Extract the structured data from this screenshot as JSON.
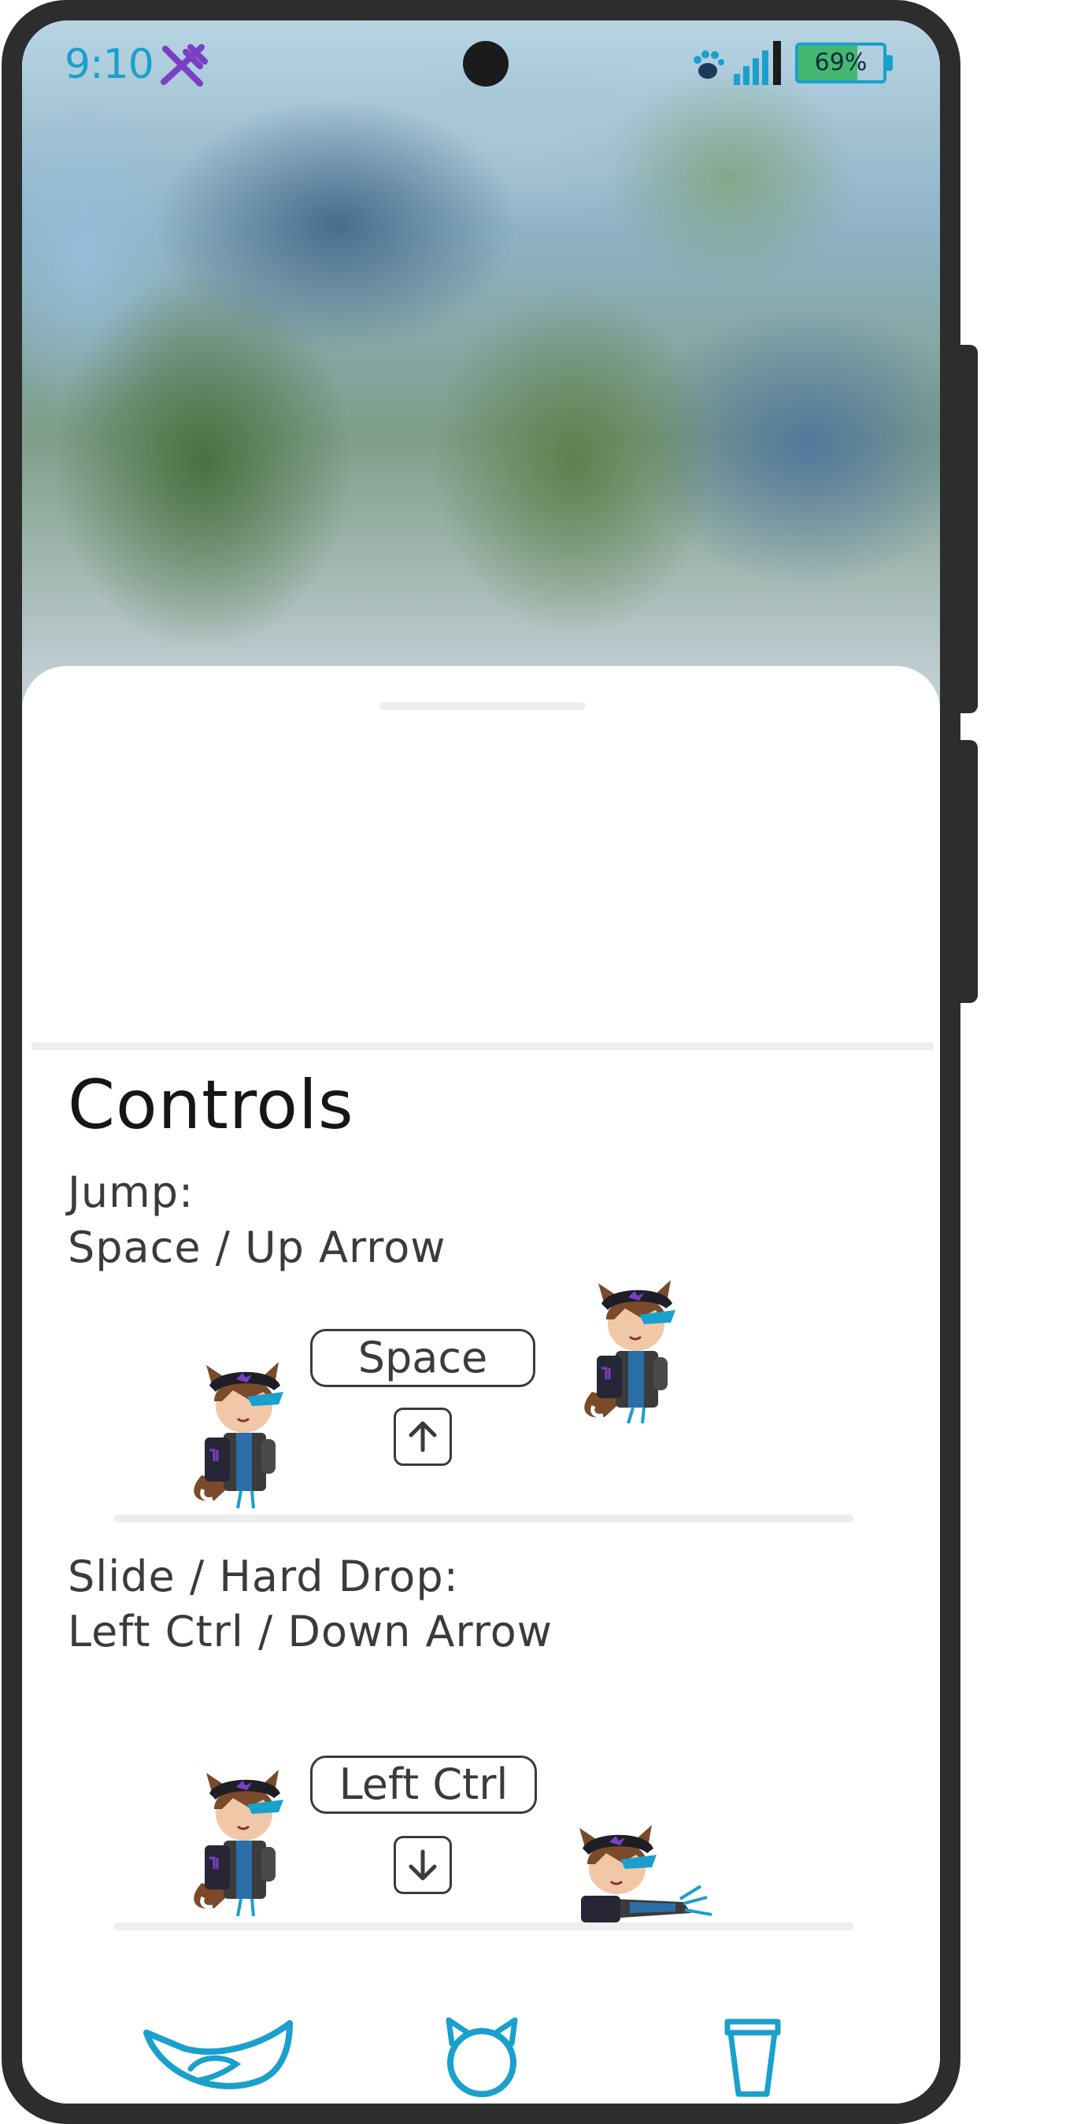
{
  "status_bar": {
    "time": "9:10",
    "time_icon": "fork-knife-icon",
    "paw_icon": "paw-icon",
    "signal_icon": "signal-bars-icon",
    "battery_percent": "69%",
    "battery_level": 0.69
  },
  "sheet": {
    "title": "Controls",
    "controls": [
      {
        "action": "Jump:",
        "keys": "Space / Up Arrow",
        "key_label": "Space",
        "arrow_icon": "arrow-up-icon"
      },
      {
        "action": "Slide / Hard Drop:",
        "keys": "Left Ctrl / Down Arrow",
        "key_label": "Left Ctrl",
        "arrow_icon": "arrow-down-icon"
      }
    ]
  },
  "bottom_nav": {
    "items": [
      {
        "icon": "tail-icon"
      },
      {
        "icon": "cat-ears-icon"
      },
      {
        "icon": "cup-icon"
      }
    ]
  },
  "colors": {
    "accent": "#1aa0cc",
    "status_purple": "#7a3fc4",
    "battery_green": "#44b870",
    "text_dark": "#161616",
    "text_body": "#3b3b3b",
    "phone_frame": "#2d2d2d"
  }
}
